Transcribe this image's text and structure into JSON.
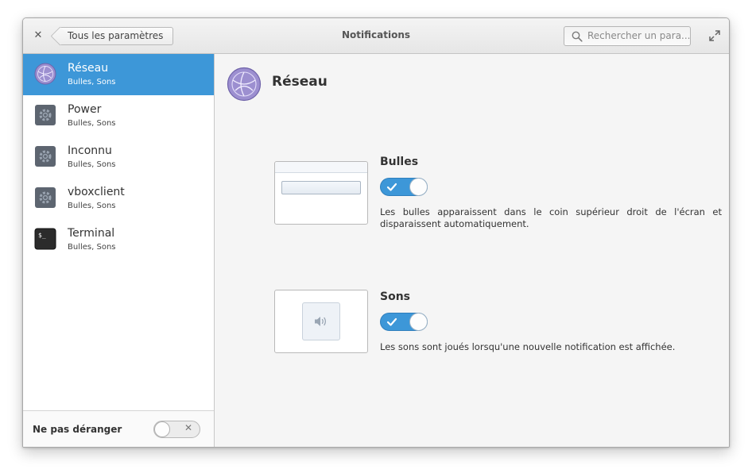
{
  "window": {
    "title": "Notifications",
    "back_label": "Tous les paramètres",
    "search_placeholder": "Rechercher un para..."
  },
  "sidebar": {
    "items": [
      {
        "name": "Réseau",
        "subtitle": "Bulles, Sons",
        "icon": "network-globe-icon",
        "selected": true
      },
      {
        "name": "Power",
        "subtitle": "Bulles, Sons",
        "icon": "gear-icon",
        "selected": false
      },
      {
        "name": "Inconnu",
        "subtitle": "Bulles, Sons",
        "icon": "gear-icon",
        "selected": false
      },
      {
        "name": "vboxclient",
        "subtitle": "Bulles, Sons",
        "icon": "gear-icon",
        "selected": false
      },
      {
        "name": "Terminal",
        "subtitle": "Bulles, Sons",
        "icon": "terminal-icon",
        "selected": false
      }
    ],
    "dnd_label": "Ne pas déranger",
    "dnd_enabled": false
  },
  "main": {
    "app_title": "Réseau",
    "bubbles": {
      "title": "Bulles",
      "enabled": true,
      "description": "Les bulles apparaissent dans le coin supérieur droit de l'écran et disparaissent automatiquement."
    },
    "sounds": {
      "title": "Sons",
      "enabled": true,
      "description": "Les sons sont joués lorsqu'une nouvelle notification est affichée."
    }
  },
  "colors": {
    "accent": "#3d97d8",
    "window_bg": "#f5f5f5",
    "sidebar_bg": "#ffffff"
  }
}
